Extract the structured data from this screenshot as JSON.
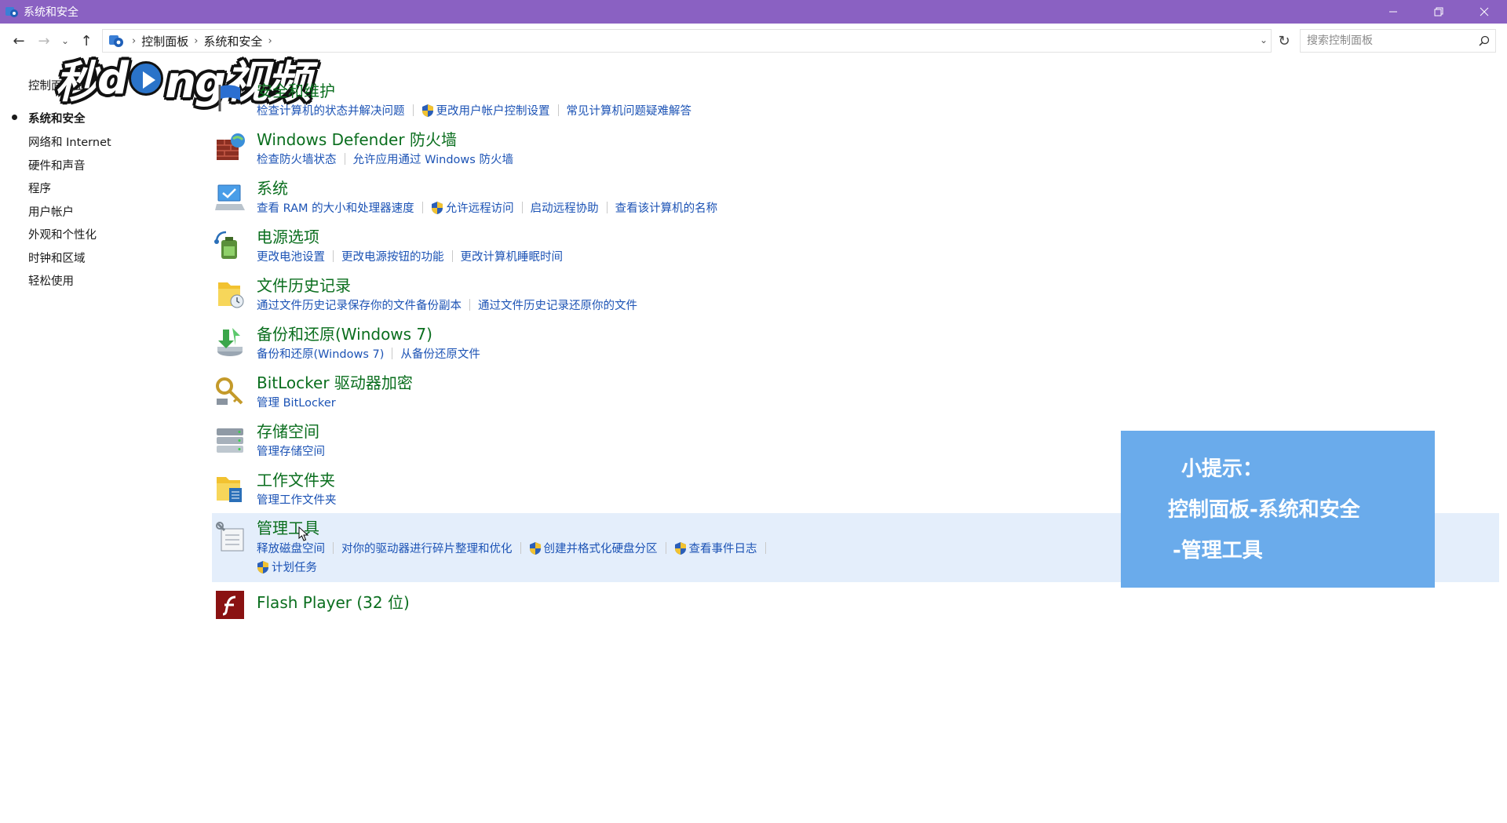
{
  "window": {
    "title": "系统和安全"
  },
  "addressbar": {
    "breadcrumbs": [
      "控制面板",
      "系统和安全"
    ],
    "search_placeholder": "搜索控制面板"
  },
  "watermark": {
    "text_left": "秒",
    "text_mid": "d",
    "text_mid2": "ng视频"
  },
  "sidebar": {
    "items": [
      {
        "label": "控制面板主页"
      },
      {
        "label": "系统和安全",
        "active": true
      },
      {
        "label": "网络和 Internet"
      },
      {
        "label": "硬件和声音"
      },
      {
        "label": "程序"
      },
      {
        "label": "用户帐户"
      },
      {
        "label": "外观和个性化"
      },
      {
        "label": "时钟和区域"
      },
      {
        "label": "轻松使用"
      }
    ]
  },
  "categories": [
    {
      "title": "安全和维护",
      "icon": "flag-icon",
      "links": [
        {
          "label": "检查计算机的状态并解决问题"
        },
        {
          "label": "更改用户帐户控制设置",
          "shield": true
        },
        {
          "label": "常见计算机问题疑难解答"
        }
      ]
    },
    {
      "title": "Windows Defender 防火墙",
      "icon": "firewall-icon",
      "links": [
        {
          "label": "检查防火墙状态"
        },
        {
          "label": "允许应用通过 Windows 防火墙"
        }
      ]
    },
    {
      "title": "系统",
      "icon": "system-icon",
      "links": [
        {
          "label": "查看 RAM 的大小和处理器速度"
        },
        {
          "label": "允许远程访问",
          "shield": true
        },
        {
          "label": "启动远程协助"
        },
        {
          "label": "查看该计算机的名称"
        }
      ]
    },
    {
      "title": "电源选项",
      "icon": "power-options-icon",
      "links": [
        {
          "label": "更改电池设置"
        },
        {
          "label": "更改电源按钮的功能"
        },
        {
          "label": "更改计算机睡眠时间"
        }
      ]
    },
    {
      "title": "文件历史记录",
      "icon": "file-history-icon",
      "links": [
        {
          "label": "通过文件历史记录保存你的文件备份副本"
        },
        {
          "label": "通过文件历史记录还原你的文件"
        }
      ]
    },
    {
      "title": "备份和还原(Windows 7)",
      "icon": "backup-restore-icon",
      "links": [
        {
          "label": "备份和还原(Windows 7)"
        },
        {
          "label": "从备份还原文件"
        }
      ]
    },
    {
      "title": "BitLocker 驱动器加密",
      "icon": "bitlocker-icon",
      "links": [
        {
          "label": "管理 BitLocker"
        }
      ]
    },
    {
      "title": "存储空间",
      "icon": "storage-spaces-icon",
      "links": [
        {
          "label": "管理存储空间"
        }
      ]
    },
    {
      "title": "工作文件夹",
      "icon": "work-folders-icon",
      "links": [
        {
          "label": "管理工作文件夹"
        }
      ]
    },
    {
      "title": "管理工具",
      "icon": "admin-tools-icon",
      "links": [
        {
          "label": "释放磁盘空间"
        },
        {
          "label": "对你的驱动器进行碎片整理和优化"
        },
        {
          "label": "创建并格式化硬盘分区",
          "shield": true
        },
        {
          "label": "查看事件日志",
          "shield": true
        }
      ],
      "links2": [
        {
          "label": "计划任务",
          "shield": true
        }
      ]
    },
    {
      "title": "Flash Player (32 位)",
      "icon": "flash-player-icon",
      "links": []
    }
  ],
  "tip": {
    "line1": "小提示：",
    "line2": "控制面板-系统和安全",
    "line3": "-管理工具"
  },
  "colors": {
    "titlebar": "#8a61c2",
    "category_title": "#0a6e1e",
    "link": "#1c53b5",
    "highlight_row": "#e4eefb",
    "tip_bg": "#6aabeb"
  }
}
